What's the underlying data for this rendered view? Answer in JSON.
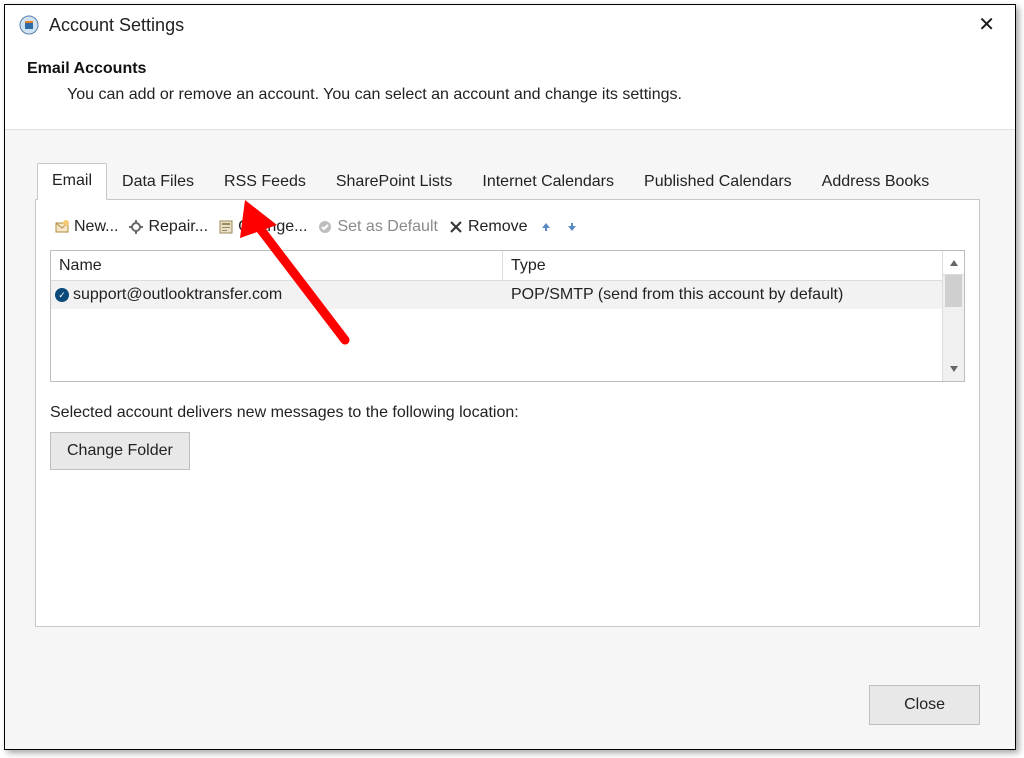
{
  "window": {
    "title": "Account Settings",
    "close_glyph": "✕"
  },
  "header": {
    "heading": "Email Accounts",
    "subtext": "You can add or remove an account. You can select an account and change its settings."
  },
  "tabs": [
    {
      "label": "Email",
      "active": true
    },
    {
      "label": "Data Files"
    },
    {
      "label": "RSS Feeds"
    },
    {
      "label": "SharePoint Lists"
    },
    {
      "label": "Internet Calendars"
    },
    {
      "label": "Published Calendars"
    },
    {
      "label": "Address Books"
    }
  ],
  "toolbar": {
    "new": "New...",
    "repair": "Repair...",
    "change": "Change...",
    "set_default": "Set as Default",
    "remove": "Remove"
  },
  "columns": {
    "name": "Name",
    "type": "Type"
  },
  "accounts": [
    {
      "name": "support@outlooktransfer.com",
      "type": "POP/SMTP (send from this account by default)",
      "default": true
    }
  ],
  "deliver_text": "Selected account delivers new messages to the following location:",
  "change_folder_label": "Change Folder",
  "close_label": "Close"
}
